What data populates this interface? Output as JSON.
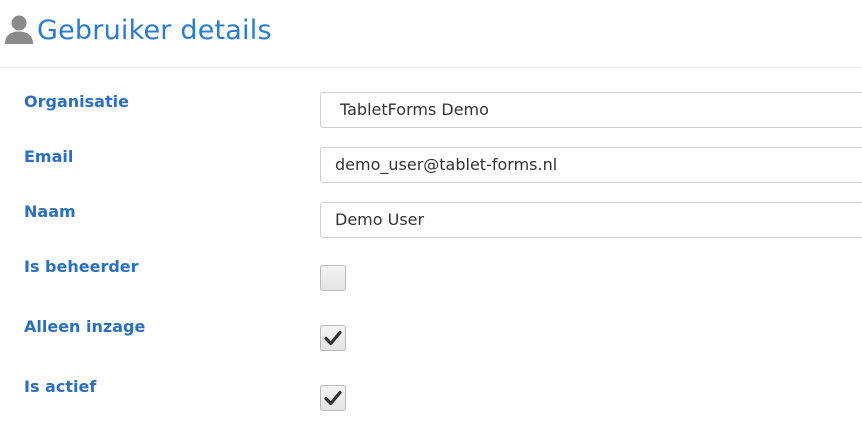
{
  "header": {
    "icon": "user-icon",
    "title": "Gebruiker details"
  },
  "form": {
    "organisatie": {
      "label": "Organisatie",
      "value": "TabletForms Demo"
    },
    "email": {
      "label": "Email",
      "value": "demo_user@tablet-forms.nl"
    },
    "naam": {
      "label": "Naam",
      "value": "Demo User"
    },
    "is_beheerder": {
      "label": "Is beheerder",
      "checked": false
    },
    "alleen_inzage": {
      "label": "Alleen inzage",
      "checked": true
    },
    "is_actief": {
      "label": "Is actief",
      "checked": true
    }
  },
  "colors": {
    "title": "#2a7bd1",
    "label": "#2a6fc0",
    "icon": "#8a8a8a"
  }
}
